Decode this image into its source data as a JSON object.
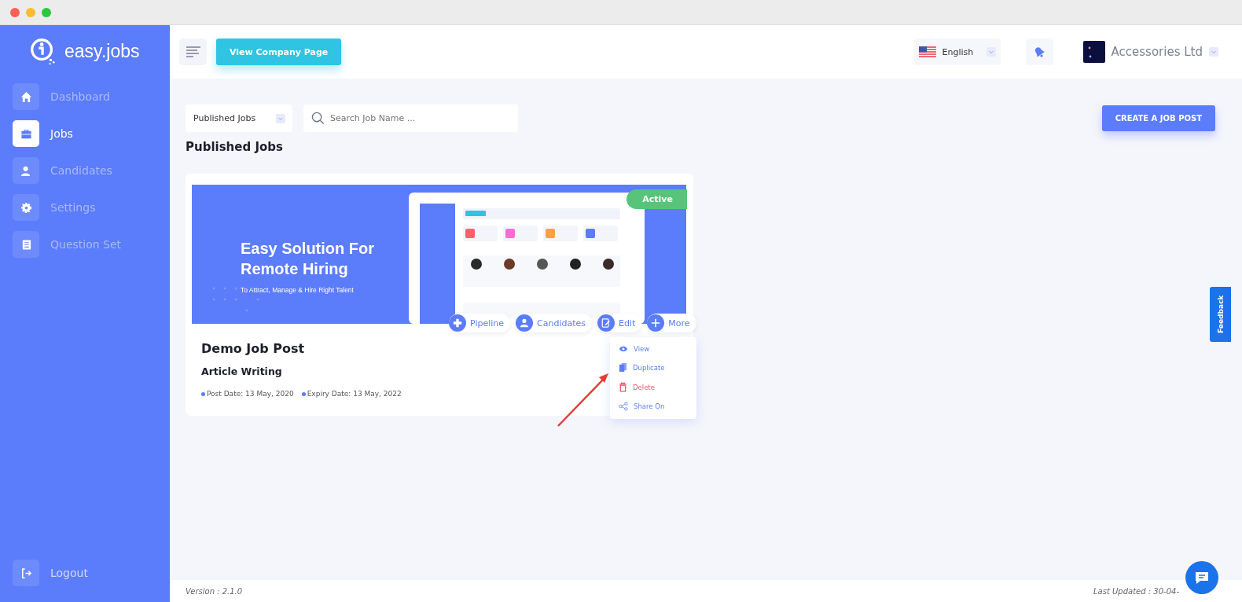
{
  "window": {
    "controls": [
      {
        "color": "#fe5f57"
      },
      {
        "color": "#febc2e"
      },
      {
        "color": "#28c840"
      }
    ]
  },
  "sidebar": {
    "logo": "easy.jobs",
    "items": [
      {
        "label": "Dashboard",
        "selected": false
      },
      {
        "label": "Jobs",
        "selected": true
      },
      {
        "label": "Candidates",
        "selected": false
      },
      {
        "label": "Settings",
        "selected": false
      },
      {
        "label": "Question Set",
        "selected": false
      }
    ],
    "logout": "Logout"
  },
  "header": {
    "company_button": "View Company Page",
    "language": "English",
    "company": "Accessories Ltd"
  },
  "filters": {
    "status": "Published Jobs",
    "search": {
      "placeholder": "Search Job Name ..."
    },
    "create_button": "CREATE A JOB POST"
  },
  "section_title": "Published Jobs",
  "job": {
    "status": "Active",
    "banner": {
      "headline": "Easy Solution For Remote Hiring",
      "tagline": "To Attract, Manage & Hire Right Talent"
    },
    "actions": [
      "Pipeline",
      "Candidates",
      "Edit",
      "More"
    ],
    "title": "Demo Job Post",
    "category": "Article Writing",
    "dates": [
      "Post Date: 13 May, 2020",
      "Expiry Date: 13 May, 2022"
    ],
    "menu": [
      {
        "label": "View",
        "kind": "normal"
      },
      {
        "label": "Duplicate",
        "kind": "normal"
      },
      {
        "label": "Delete",
        "kind": "danger"
      },
      {
        "label": "Share On",
        "kind": "normal"
      }
    ]
  },
  "feedback": "Feedback",
  "footer": {
    "version": "Version : 2.1.0",
    "updated": "Last Updated : 30-04-"
  }
}
